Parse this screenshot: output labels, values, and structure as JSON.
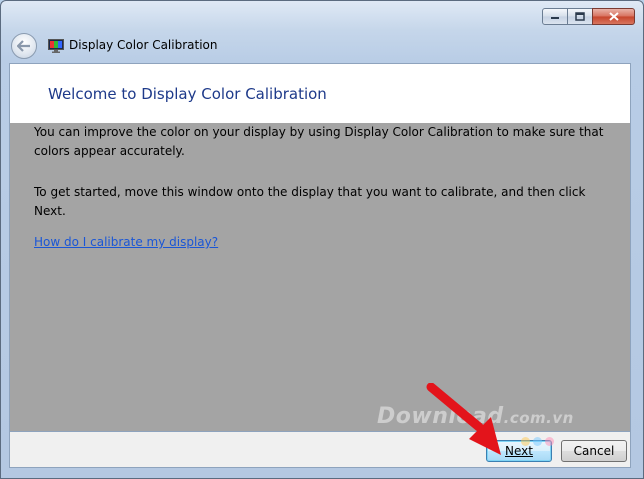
{
  "window": {
    "title": "Display Color Calibration",
    "controls": {
      "minimize": "minimize-icon",
      "maximize": "maximize-icon",
      "close": "close-icon"
    }
  },
  "header": {
    "heading": "Welcome to Display Color Calibration"
  },
  "body": {
    "paragraph1": "You can improve the color on your display by using Display Color Calibration to make sure that colors appear accurately.",
    "paragraph2": "To get started, move this window onto the display that you want to calibrate, and then click Next.",
    "help_link": "How do I calibrate my display?"
  },
  "footer": {
    "next_label": "Next",
    "cancel_label": "Cancel"
  },
  "watermark": {
    "main": "Download",
    "suffix": ".com.vn"
  },
  "colors": {
    "accent": "#1e3a8a",
    "link": "#1a56d6",
    "arrow": "#e3141b",
    "content_bg": "#a4a4a4"
  }
}
